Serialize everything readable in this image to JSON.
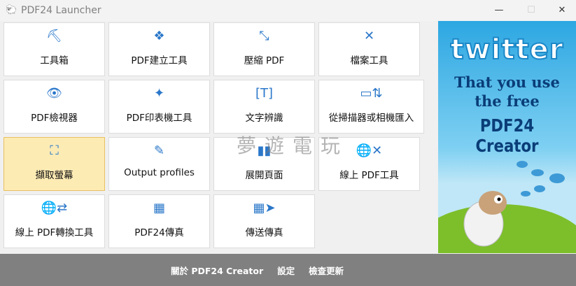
{
  "window": {
    "title": "PDF24 Launcher",
    "minimize": "—",
    "maximize": "☐",
    "close": "✕"
  },
  "tiles": [
    {
      "label": "工具箱",
      "icon": "toolbox-icon"
    },
    {
      "label": "PDF建立工具",
      "icon": "cubes-icon"
    },
    {
      "label": "壓縮 PDF",
      "icon": "compress-icon"
    },
    {
      "label": "檔案工具",
      "icon": "tools-icon"
    },
    {
      "label": "PDF檢視器",
      "icon": "eye-icon"
    },
    {
      "label": "PDF印表機工具",
      "icon": "printer-badge-icon"
    },
    {
      "label": "文字辨識",
      "icon": "ocr-icon"
    },
    {
      "label": "從掃描器或相機匯入",
      "icon": "scanner-icon"
    },
    {
      "label": "擷取螢幕",
      "icon": "screenshot-icon"
    },
    {
      "label": "Output profiles",
      "icon": "profile-edit-icon"
    },
    {
      "label": "展開頁面",
      "icon": "pages-icon"
    },
    {
      "label": "線上 PDF工具",
      "icon": "globe-tools-icon"
    },
    {
      "label": "線上 PDF轉換工具",
      "icon": "globe-convert-icon"
    },
    {
      "label": "PDF24傳真",
      "icon": "fax-icon"
    },
    {
      "label": "傳送傳真",
      "icon": "send-fax-icon"
    }
  ],
  "ad": {
    "brand": "twitter",
    "line1": "That you use",
    "line2": "the free",
    "line3": "PDF24 Creator"
  },
  "watermark": "夢遊電玩",
  "footer": {
    "about": "關於 PDF24 Creator",
    "settings": "設定",
    "update": "檢查更新"
  }
}
